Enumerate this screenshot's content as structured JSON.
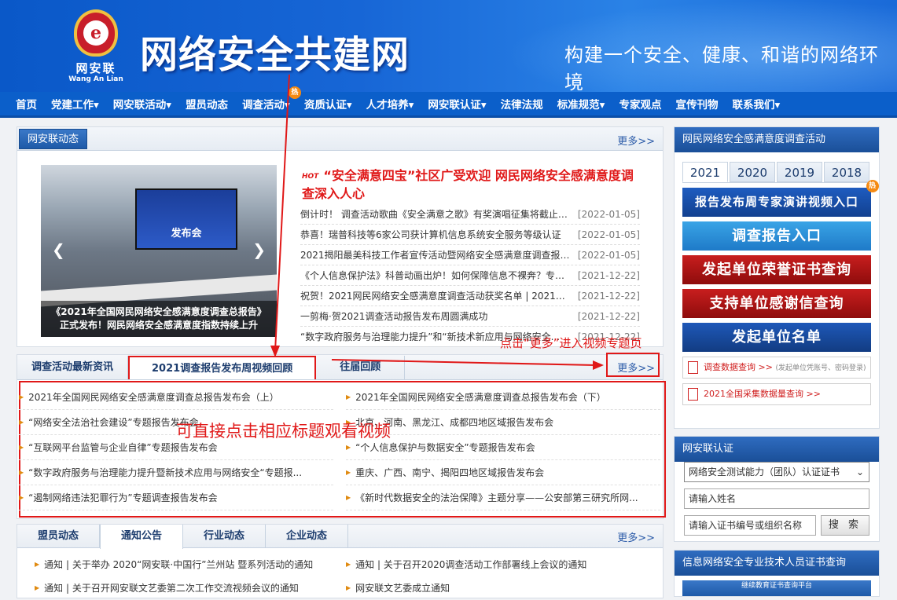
{
  "brand": {
    "logo_cn": "网安联",
    "logo_en": "Wang An Lian",
    "logo_letter": "e",
    "title": "网络安全共建网",
    "slogan": "构建一个安全、健康、和谐的网络环境"
  },
  "nav": [
    "首页",
    "党建工作▾",
    "网安联活动▾",
    "盟员动态",
    "调查活动▾",
    "资质认证▾",
    "人才培养▾",
    "网安联认证▾",
    "法律法规",
    "标准规范▾",
    "专家观点",
    "宣传刊物",
    "联系我们▾"
  ],
  "nav_hot": "热",
  "news": {
    "tab": "网安联动态",
    "more": "更多>>",
    "photo_screen": "发布会",
    "photo_caption": "《2021年全国网民网络安全感满意度调查总报告》正式发布！网民网络安全感满意度指数持续上升",
    "hot_label": "HOT",
    "headline": "“安全满意四宝”社区广受欢迎 网民网络安全感满意度调查深入人心",
    "items": [
      {
        "t": "倒计时！ 调查活动歌曲《安全满意之歌》有奖演唱征集将截止，...",
        "d": "[2022-01-05]"
      },
      {
        "t": "恭喜！瑞普科技等6家公司获计算机信息系统安全服务等级认证",
        "d": "[2022-01-05]"
      },
      {
        "t": "2021揭阳最美科技工作者宣传活动暨网络安全感满意度调查报告...",
        "d": "[2022-01-05]"
      },
      {
        "t": "《个人信息保护法》科普动画出炉！如何保障信息不裸奔？专家...",
        "d": "[2021-12-22]"
      },
      {
        "t": "祝贺！2021网民网络安全感满意度调查活动获奖名单 | 2021调查...",
        "d": "[2021-12-22]"
      },
      {
        "t": "一剪梅·贺2021调查活动报告发布周圆满成功",
        "d": "[2021-12-22]"
      },
      {
        "t": "“数字政府服务与治理能力提升”和“新技术新应用与网络安全...",
        "d": "[2021-12-22]"
      }
    ]
  },
  "video": {
    "tabs": [
      "调查活动最新资讯",
      "2021调查报告发布周视频回顾",
      "往届回顾"
    ],
    "more": "更多>>",
    "left": [
      "2021年全国网民网络安全感满意度调查总报告发布会（上）",
      "“网络安全法治社会建设”专题报告发布会",
      "“互联网平台监管与企业自律”专题报告发布会",
      "“数字政府服务与治理能力提升暨新技术应用与网络安全“专题报...",
      "“遏制网络违法犯罪行为”专题调查报告发布会"
    ],
    "right": [
      "2021年全国网民网络安全感满意度调查总报告发布会（下）",
      "北京、河南、黑龙江、成都四地区域报告发布会",
      "“个人信息保护与数据安全”专题报告发布会",
      "重庆、广西、南宁、揭阳四地区域报告发布会",
      "《新时代数据安全的法治保障》主题分享——公安部第三研究所网..."
    ],
    "annot_more": "点击“更多”进入视频专题页",
    "annot_list": "可直接点击相应标题观看视频"
  },
  "notice": {
    "tabs": [
      "盟员动态",
      "通知公告",
      "行业动态",
      "企业动态"
    ],
    "more": "更多>>",
    "items": [
      "通知 | 关于举办 2020“网安联·中国行”兰州站 暨系列活动的通知",
      "通知 | 关于召开2020调查活动工作部署线上会议的通知",
      "通知 | 关于召开网安联文艺委第二次工作交流视频会议的通知",
      "网安联文艺委成立通知"
    ]
  },
  "survey": {
    "title": "网民网络安全感满意度调查活动",
    "years": [
      "2021",
      "2020",
      "2019",
      "2018"
    ],
    "buttons": [
      "报告发布周专家演讲视频入口",
      "调查报告入口",
      "发起单位荣誉证书查询",
      "支持单位感谢信查询",
      "发起单位名单"
    ],
    "link1": "调查数据查询 >>",
    "link1_sub": "(发起单位凭账号、密码登录)",
    "link2": "2021全国采集数据量查询 >>"
  },
  "cert": {
    "title": "网安联认证",
    "select": "网络安全测试能力（团队）认证证书",
    "name_ph": "请输入姓名",
    "no_ph": "请输入证书编号或组织名称",
    "search": "搜 索"
  },
  "cert2": {
    "title": "信息网络安全专业技术人员证书查询",
    "banner": "继续教育证书查询平台"
  },
  "colors": {
    "accent": "#0b5fca",
    "highlight": "#e01818"
  }
}
